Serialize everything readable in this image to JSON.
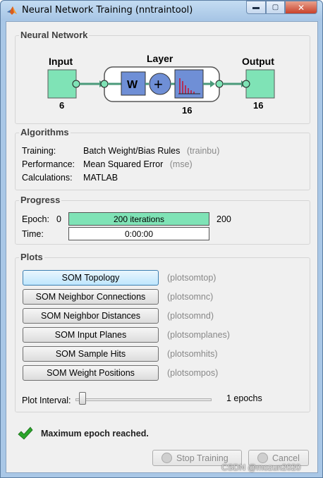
{
  "window": {
    "title": "Neural Network Training (nntraintool)",
    "min_glyph": "▬",
    "max_glyph": "▢",
    "close_glyph": "✕"
  },
  "network": {
    "section_title": "Neural Network",
    "input_label": "Input",
    "input_size": "6",
    "layer_label": "Layer",
    "layer_size": "16",
    "weight_symbol": "W",
    "bias_symbol": "+",
    "output_label": "Output",
    "output_size": "16"
  },
  "algorithms": {
    "section_title": "Algorithms",
    "rows": [
      {
        "label": "Training:",
        "value": "Batch Weight/Bias Rules",
        "note": "(trainbu)"
      },
      {
        "label": "Performance:",
        "value": "Mean Squared Error",
        "note": "(mse)"
      },
      {
        "label": "Calculations:",
        "value": "MATLAB",
        "note": ""
      }
    ]
  },
  "progress": {
    "section_title": "Progress",
    "epoch_label": "Epoch:",
    "epoch_start": "0",
    "epoch_bar_text": "200 iterations",
    "epoch_end": "200",
    "epoch_fraction": 1.0,
    "time_label": "Time:",
    "time_value": "0:00:00"
  },
  "plots": {
    "section_title": "Plots",
    "buttons": [
      {
        "label": "SOM Topology",
        "cmd": "(plotsomtop)"
      },
      {
        "label": "SOM Neighbor Connections",
        "cmd": "(plotsomnc)"
      },
      {
        "label": "SOM Neighbor Distances",
        "cmd": "(plotsomnd)"
      },
      {
        "label": "SOM Input Planes",
        "cmd": "(plotsomplanes)"
      },
      {
        "label": "SOM Sample Hits",
        "cmd": "(plotsomhits)"
      },
      {
        "label": "SOM Weight Positions",
        "cmd": "(plotsompos)"
      }
    ],
    "interval_label": "Plot Interval:",
    "interval_value": "1 epochs"
  },
  "status": {
    "message": "Maximum epoch reached."
  },
  "actions": {
    "stop_label": "Stop Training",
    "cancel_label": "Cancel"
  },
  "watermark": "CSDN @mozun2020",
  "colors": {
    "node_fill": "#7fe3b6",
    "block_fill": "#6f8fd6",
    "progress_fill": "#7fe3b6",
    "check_green": "#2aa52a"
  }
}
